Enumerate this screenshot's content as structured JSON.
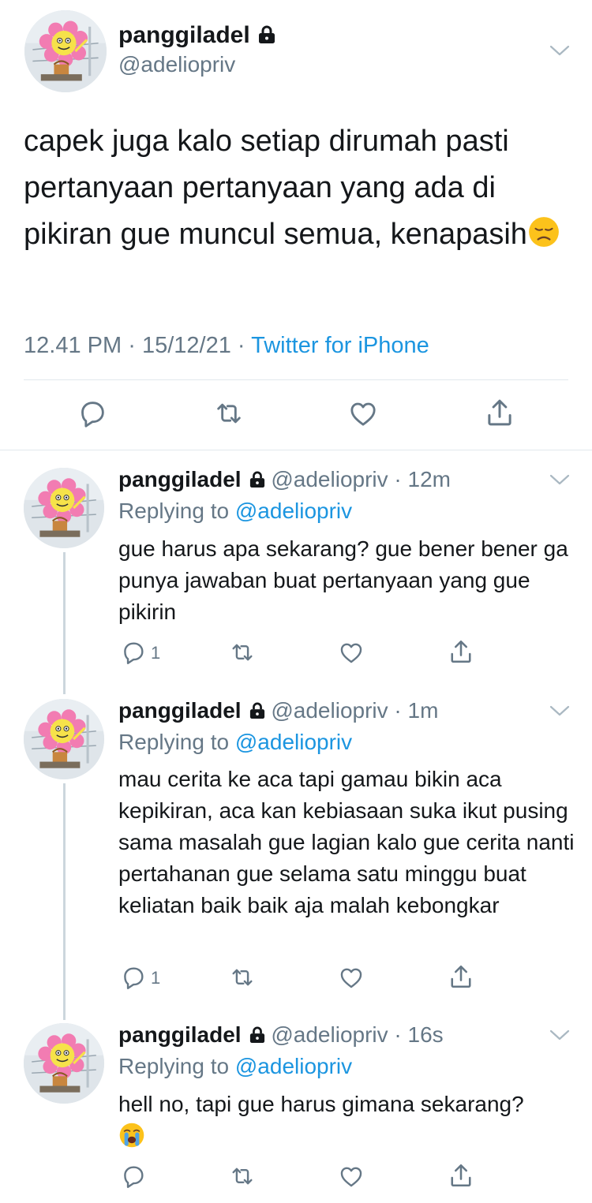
{
  "main_tweet": {
    "display_name": "panggiladel",
    "handle": "@adeliopriv",
    "text": "capek juga kalo setiap dirumah pasti pertanyaan pertanyaan yang ada di pikiran gue muncul semua, kenapasih",
    "text_emoji": "disappointed-face",
    "time": "12.41 PM",
    "date": "15/12/21",
    "source": "Twitter for iPhone",
    "separator": "·"
  },
  "replies": [
    {
      "display_name": "panggiladel",
      "handle": "@adeliopriv",
      "time": "12m",
      "replying_label": "Replying to",
      "replying_to": "@adeliopriv",
      "text": "gue harus apa sekarang? gue bener bener ga punya jawaban buat pertanyaan yang gue pikirin",
      "reply_count": "1"
    },
    {
      "display_name": "panggiladel",
      "handle": "@adeliopriv",
      "time": "1m",
      "replying_label": "Replying to",
      "replying_to": "@adeliopriv",
      "text": "mau cerita ke aca tapi gamau bikin aca kepikiran, aca kan kebiasaan suka ikut pusing sama masalah gue lagian kalo gue cerita nanti pertahanan gue selama satu minggu buat keliatan baik baik aja malah kebongkar",
      "reply_count": "1"
    },
    {
      "display_name": "panggiladel",
      "handle": "@adeliopriv",
      "time": "16s",
      "replying_label": "Replying to",
      "replying_to": "@adeliopriv",
      "text": "hell no, tapi gue harus gimana sekarang?",
      "text_emoji": "loudly-crying-face",
      "reply_count": ""
    }
  ],
  "colors": {
    "accent": "#1b95e0",
    "secondary_text": "#657786",
    "primary_text": "#14171a",
    "divider": "#e1e8ed"
  }
}
